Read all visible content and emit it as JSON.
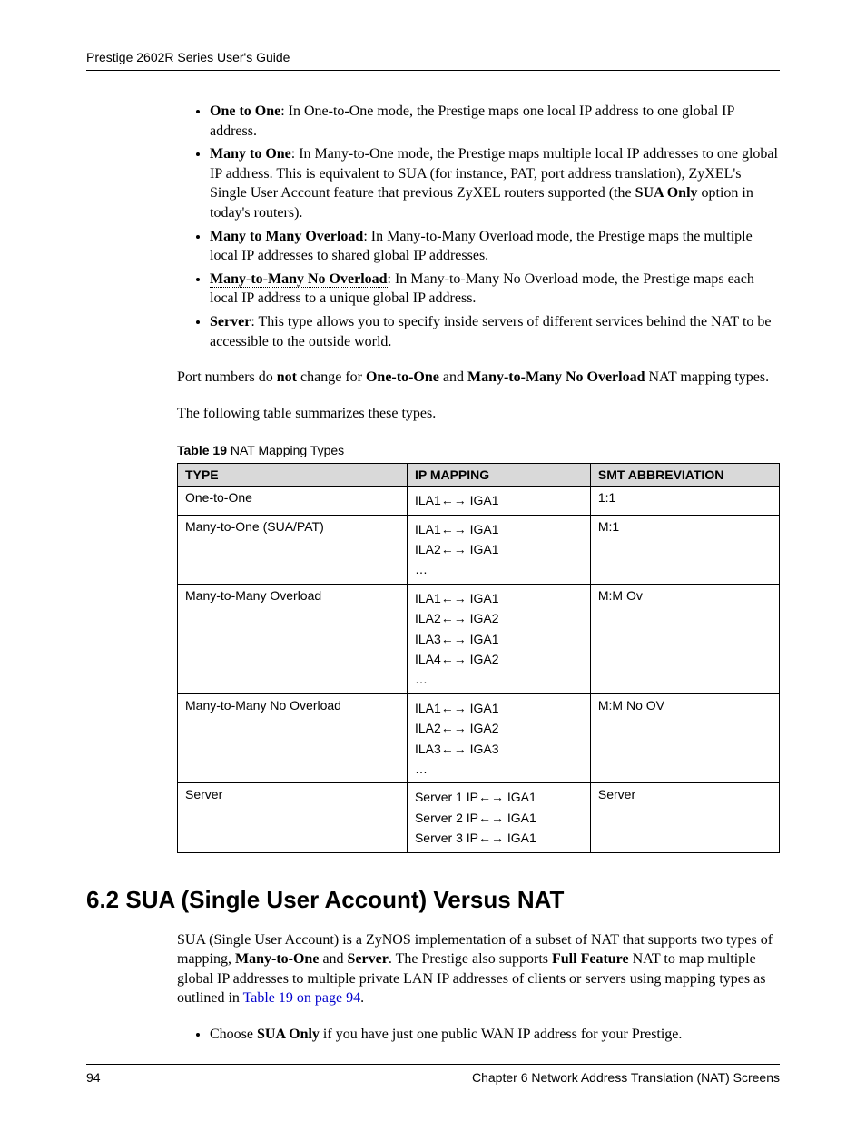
{
  "header": {
    "text": "Prestige 2602R Series User's Guide"
  },
  "bullets1": [
    {
      "term": "One to One",
      "desc": ": In One-to-One mode, the Prestige maps one local IP address to one global IP address."
    },
    {
      "term": "Many to One",
      "desc_pre": ": In Many-to-One mode, the Prestige maps multiple local IP addresses to one global IP address. This is equivalent to SUA (for instance, PAT, port address translation), ZyXEL's Single User Account feature that previous ZyXEL routers supported (the ",
      "bold_mid": "SUA Only",
      "desc_post": " option in today's routers)."
    },
    {
      "term": "Many to Many Overload",
      "desc": ": In Many-to-Many Overload mode, the Prestige maps the multiple local IP addresses to shared global IP addresses."
    },
    {
      "term": "Many-to-Many No Overload",
      "underline": true,
      "desc": ": In Many-to-Many No Overload mode, the Prestige maps each local IP address to a unique global IP address."
    },
    {
      "term": "Server",
      "desc": ": This type allows you to specify inside servers of different services behind the NAT to be accessible to the outside world."
    }
  ],
  "port_para": {
    "pre": "Port numbers do ",
    "b1": "not",
    "mid": " change for ",
    "b2": "One-to-One",
    "mid2": " and ",
    "b3": "Many-to-Many No Overload",
    "post": " NAT mapping types."
  },
  "summary_para": "The following table summarizes these types.",
  "table_caption": {
    "label": "Table 19",
    "title": "   NAT Mapping Types"
  },
  "table": {
    "headers": [
      "TYPE",
      "IP MAPPING",
      "SMT ABBREVIATION"
    ],
    "rows": [
      {
        "type": "One-to-One",
        "mapping": [
          "ILA1←→ IGA1"
        ],
        "abbr": "1:1"
      },
      {
        "type": "Many-to-One (SUA/PAT)",
        "mapping": [
          "ILA1←→ IGA1",
          "ILA2←→ IGA1",
          "…"
        ],
        "abbr": "M:1"
      },
      {
        "type": "Many-to-Many Overload",
        "mapping": [
          "ILA1←→ IGA1",
          "ILA2←→ IGA2",
          "ILA3←→ IGA1",
          "ILA4←→ IGA2",
          "…"
        ],
        "abbr": "M:M Ov"
      },
      {
        "type": "Many-to-Many No Overload",
        "mapping": [
          "ILA1←→ IGA1",
          "ILA2←→ IGA2",
          "ILA3←→ IGA3",
          "…"
        ],
        "abbr": "M:M No OV"
      },
      {
        "type": "Server",
        "mapping": [
          "Server 1 IP←→ IGA1",
          "Server 2 IP←→ IGA1",
          "Server 3 IP←→ IGA1"
        ],
        "abbr": "Server"
      }
    ]
  },
  "section_heading": "6.2  SUA (Single User Account) Versus NAT",
  "sua_para": {
    "pre": "SUA (Single User Account) is a ZyNOS implementation of a subset of NAT that supports two types of mapping, ",
    "b1": "Many-to-One",
    "mid1": " and ",
    "b2": "Server",
    "mid2": ". The Prestige also supports ",
    "b3": "Full Feature",
    "post_pre_link": " NAT to map multiple global IP addresses to multiple private LAN IP addresses of clients or servers using mapping types as outlined in ",
    "link": "Table 19 on page 94",
    "post": "."
  },
  "bullets2": [
    {
      "pre": "Choose ",
      "bold": "SUA Only",
      "post": " if you have just one public WAN IP address for your Prestige."
    }
  ],
  "footer": {
    "page": "94",
    "chapter": "Chapter 6 Network Address Translation (NAT) Screens"
  }
}
